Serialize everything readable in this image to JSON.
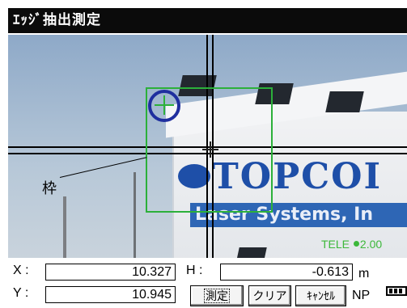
{
  "window": {
    "title": "ｴｯｼﾞ抽出測定"
  },
  "view": {
    "callout_label": "枠",
    "logo_text": "TOPCOI",
    "strip_text": "Laser Systems, In",
    "zoom": {
      "prefix": "TELE",
      "value": "2.00"
    }
  },
  "readout": {
    "x": {
      "label": "X :",
      "value": "10.327"
    },
    "y": {
      "label": "Y :",
      "value": "10.945"
    },
    "h": {
      "label": "H :",
      "value": "-0.613",
      "unit": "m"
    }
  },
  "buttons": {
    "measure": "測定",
    "clear": "クリア",
    "cancel": "ｷｬﾝｾﾙ"
  },
  "status": {
    "np": "NP"
  },
  "colors": {
    "frame": "#2cb03a",
    "circle": "#1f2f9f",
    "logo": "#1e4fa8"
  },
  "icons": [
    "crosshair-icon",
    "battery-icon"
  ]
}
